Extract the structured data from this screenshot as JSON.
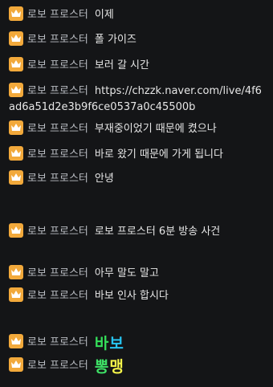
{
  "chat": {
    "badge_icon": "crown-icon",
    "badge_color": "#f2a93b",
    "messages": [
      {
        "nick": "로보 프로스터",
        "text": "이제"
      },
      {
        "nick": "로보 프로스터",
        "text": "폴 가이즈"
      },
      {
        "nick": "로보 프로스터",
        "text": "보러 갈 시간"
      },
      {
        "nick": "로보 프로스터",
        "text": "https://chzzk.naver.com/live/4f6ad6a51d2e3b9f6ce0537a0c45500b"
      },
      {
        "nick": "로보 프로스터",
        "text": "부재중이었기 때문에 켰으나"
      },
      {
        "nick": "로보 프로스터",
        "text": "바로 왔기 때문에 가게 됩니다"
      },
      {
        "nick": "로보 프로스터",
        "text": "안녕"
      },
      {
        "nick": "로보 프로스터",
        "text": "로보 프로스터 6분 방송 사건"
      },
      {
        "nick": "로보 프로스터",
        "text": "아무 말도 말고"
      },
      {
        "nick": "로보 프로스터",
        "text": "바보 인사 합시다"
      },
      {
        "nick": "로보 프로스터",
        "emote": [
          "바",
          "보"
        ]
      },
      {
        "nick": "로보 프로스터",
        "emote": [
          "뽕",
          "맹"
        ]
      }
    ]
  }
}
